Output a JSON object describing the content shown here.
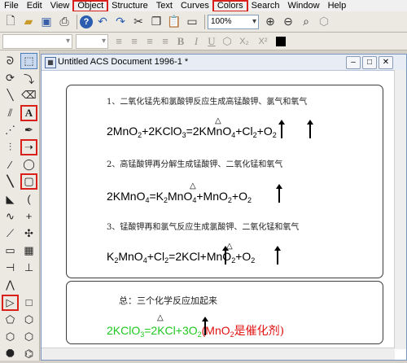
{
  "menubar": {
    "items": [
      {
        "label": "File"
      },
      {
        "label": "Edit"
      },
      {
        "label": "View"
      },
      {
        "label": "Object"
      },
      {
        "label": "Structure"
      },
      {
        "label": "Text"
      },
      {
        "label": "Curves"
      },
      {
        "label": "Colors"
      },
      {
        "label": "Search"
      },
      {
        "label": "Window"
      },
      {
        "label": "Help"
      }
    ]
  },
  "toolbar": {
    "zoom_value": "100%"
  },
  "format_bar": {
    "bold": "B",
    "italic": "I",
    "underline": "U",
    "subscript": "X₂",
    "superscript": "X²"
  },
  "document": {
    "title": "Untitled ACS Document 1996-1 *",
    "step1_text": "1、二氧化锰先和氯酸钾反应生成高锰酸钾、氯气和氧气",
    "eq1_lhs": "2MnO",
    "eq1_lhs_sub": "2",
    "eq1_plus": "+2KClO",
    "eq1_kclo_sub": "3",
    "eq1_rhs": "=2KMnO",
    "eq1_rhs_sub": "4",
    "eq1_rhs2": "+Cl",
    "eq1_cl_sub": "2",
    "eq1_rhs3": "+O",
    "eq1_o_sub": "2",
    "step2_text": "2、高锰酸钾再分解生成锰酸钾、二氧化锰和氧气",
    "eq2_a": "2KMnO",
    "eq2_a_sub": "4",
    "eq2_b": "=K",
    "eq2_b_sub": "2",
    "eq2_c": "MnO",
    "eq2_c_sub": "4",
    "eq2_d": "+MnO",
    "eq2_d_sub": "2",
    "eq2_e": "+O",
    "eq2_e_sub": "2",
    "step3_text": "3、锰酸钾再和氯气反应生成氯酸钾、二氧化锰和氧气",
    "eq3_a": "K",
    "eq3_a_sub": "2",
    "eq3_b": "MnO",
    "eq3_b_sub": "4",
    "eq3_c": "+Cl",
    "eq3_c_sub": "2",
    "eq3_d": "=2KCl+MnO",
    "eq3_d_sub": "2",
    "eq3_e": "+O",
    "eq3_e_sub": "2",
    "summary_text": "总：三个化学反应加起来",
    "sum_a": "2KClO",
    "sum_a_sub": "3",
    "sum_b": "=2KCl+3O",
    "sum_b_sub": "2",
    "sum_c": "(MnO",
    "sum_c_sub": "2",
    "sum_d": "是催化剂)",
    "delta": "△"
  },
  "colors": {
    "highlight": "#d9201b",
    "green_eq": "#1ec81e",
    "red_note": "#e01010"
  }
}
